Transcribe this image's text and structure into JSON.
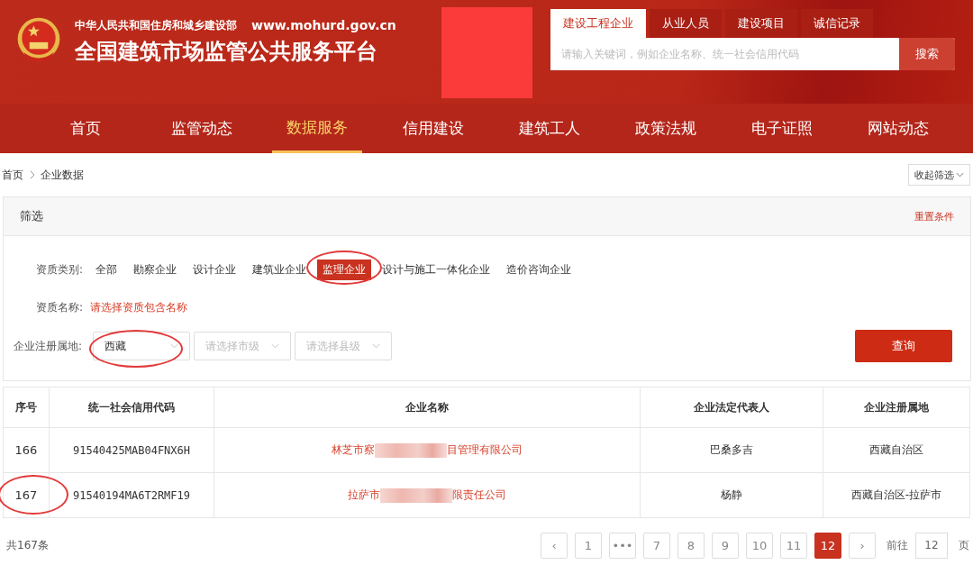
{
  "header": {
    "ministry": "中华人民共和国住房和城乡建设部",
    "url": "www.mohurd.gov.cn",
    "title": "全国建筑市场监管公共服务平台"
  },
  "search_tabs": [
    {
      "label": "建设工程企业",
      "selected": true
    },
    {
      "label": "从业人员",
      "selected": false
    },
    {
      "label": "建设项目",
      "selected": false
    },
    {
      "label": "诚信记录",
      "selected": false
    }
  ],
  "search": {
    "placeholder": "请输入关键词，例如企业名称、统一社会信用代码",
    "button": "搜索"
  },
  "nav": [
    {
      "label": "首页",
      "selected": false
    },
    {
      "label": "监管动态",
      "selected": false
    },
    {
      "label": "数据服务",
      "selected": true
    },
    {
      "label": "信用建设",
      "selected": false
    },
    {
      "label": "建筑工人",
      "selected": false
    },
    {
      "label": "政策法规",
      "selected": false
    },
    {
      "label": "电子证照",
      "selected": false
    },
    {
      "label": "网站动态",
      "selected": false
    }
  ],
  "breadcrumb": [
    "首页",
    "企业数据"
  ],
  "collapse_button": "收起筛选",
  "filter": {
    "title": "筛选",
    "reset": "重置条件",
    "category_label": "资质类别:",
    "categories": [
      {
        "label": "全部",
        "selected": false
      },
      {
        "label": "勘察企业",
        "selected": false
      },
      {
        "label": "设计企业",
        "selected": false
      },
      {
        "label": "建筑业企业",
        "selected": false
      },
      {
        "label": "监理企业",
        "selected": true
      },
      {
        "label": "设计与施工一体化企业",
        "selected": false
      },
      {
        "label": "造价咨询企业",
        "selected": false
      }
    ],
    "qualification_label": "资质名称:",
    "qualification_link": "请选择资质包含名称",
    "region_label": "企业注册属地:",
    "region_selects": [
      {
        "value": "西藏"
      },
      {
        "placeholder": "请选择市级"
      },
      {
        "placeholder": "请选择县级"
      }
    ],
    "query_button": "查询"
  },
  "table": {
    "columns": [
      "序号",
      "统一社会信用代码",
      "企业名称",
      "企业法定代表人",
      "企业注册属地"
    ],
    "rows": [
      {
        "index": "166",
        "code": "91540425MAB04FNX6H",
        "name_start": "林芝市察",
        "name_end": "目管理有限公司",
        "representative": "巴桑多吉",
        "region": "西藏自治区"
      },
      {
        "index": "167",
        "code": "91540194MA6T2RMF19",
        "name_start": "拉萨市",
        "name_end": "限责任公司",
        "representative": "杨静",
        "region": "西藏自治区-拉萨市"
      }
    ]
  },
  "pagination": {
    "total": "共167条",
    "prev": "‹",
    "next": "›",
    "pages": [
      {
        "label": "1",
        "selected": false
      },
      {
        "label": "•••",
        "selected": false
      },
      {
        "label": "7",
        "selected": false
      },
      {
        "label": "8",
        "selected": false
      },
      {
        "label": "9",
        "selected": false
      },
      {
        "label": "10",
        "selected": false
      },
      {
        "label": "11",
        "selected": false
      },
      {
        "label": "12",
        "selected": true
      }
    ],
    "goto_label": "前往",
    "goto_value": "12",
    "goto_suffix": "页"
  }
}
